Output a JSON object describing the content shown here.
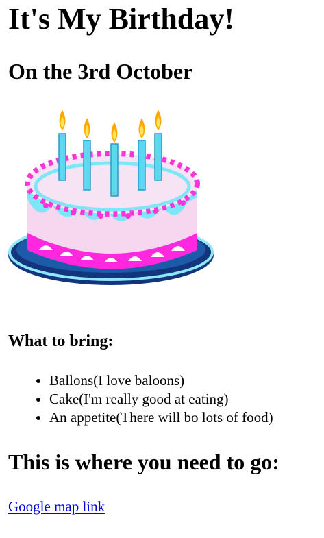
{
  "page": {
    "title": "It's My Birthday!",
    "date_heading": "On the 3rd October"
  },
  "image": {
    "icon": "birthday-cake-icon",
    "colors": {
      "candle": "#5ed8f0",
      "flame_outer": "#ffa800",
      "flame_inner": "#ffe45a",
      "frosting_top": "#f6e4f4",
      "rim": "#ff34d8",
      "icing_blue": "#7fe6f7",
      "base_magenta": "#ff28de",
      "plate": "#13357e"
    }
  },
  "bring": {
    "heading": "What to bring:",
    "items": [
      "Ballons(I love baloons)",
      "Cake(I'm really good at eating)",
      "An appetite(There will bo lots of food)"
    ]
  },
  "location": {
    "heading": "This is where you need to go:",
    "link_text": "Google map link"
  }
}
